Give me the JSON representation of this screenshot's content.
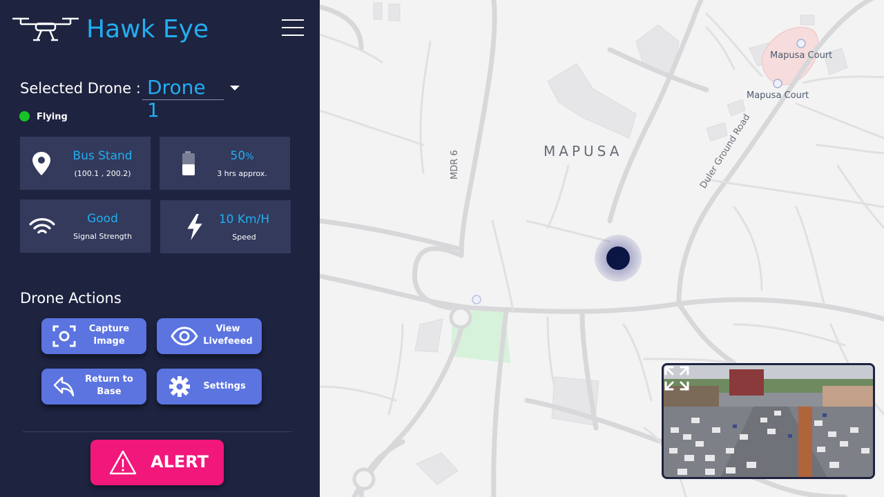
{
  "app": {
    "title": "Hawk Eye"
  },
  "drone_select": {
    "label": "Selected Drone :",
    "value": "Drone 1"
  },
  "status": {
    "text": "Flying",
    "color": "#17c227"
  },
  "cards": {
    "location": {
      "main": "Bus Stand",
      "sub": "(100.1 , 200.2)",
      "icon": "location-pin-icon"
    },
    "battery": {
      "main": "50",
      "main_unit": "%",
      "sub": "3 hrs approx.",
      "icon": "battery-icon",
      "level": 0.5
    },
    "signal": {
      "main": "Good",
      "sub": "Signal Strength",
      "icon": "wifi-icon"
    },
    "speed": {
      "main": "10 Km/H",
      "sub": "Speed",
      "icon": "lightning-icon"
    }
  },
  "actions": {
    "title": "Drone Actions",
    "capture": {
      "line1": "Capture",
      "line2": "Image",
      "icon": "camera-focus-icon"
    },
    "live": {
      "line1": "View",
      "line2": "Livefeeed",
      "icon": "eye-icon"
    },
    "return": {
      "line1": "Return to",
      "line2": "Base",
      "icon": "return-arrow-icon"
    },
    "settings": {
      "label": "Settings",
      "icon": "gear-icon"
    }
  },
  "alert": {
    "label": "ALERT",
    "icon": "warning-triangle-icon"
  },
  "map": {
    "place_label": "MAPUSA",
    "court_label_1": "Mapusa Court",
    "court_label_2": "Mapusa Court",
    "road_mdr": "MDR 6",
    "road_duler": "Duler Ground Road"
  },
  "colors": {
    "sidebar": "#1e2340",
    "accent": "#22aef0",
    "button": "#5b74e0",
    "alert": "#f1177b",
    "card": "#333a5c"
  }
}
